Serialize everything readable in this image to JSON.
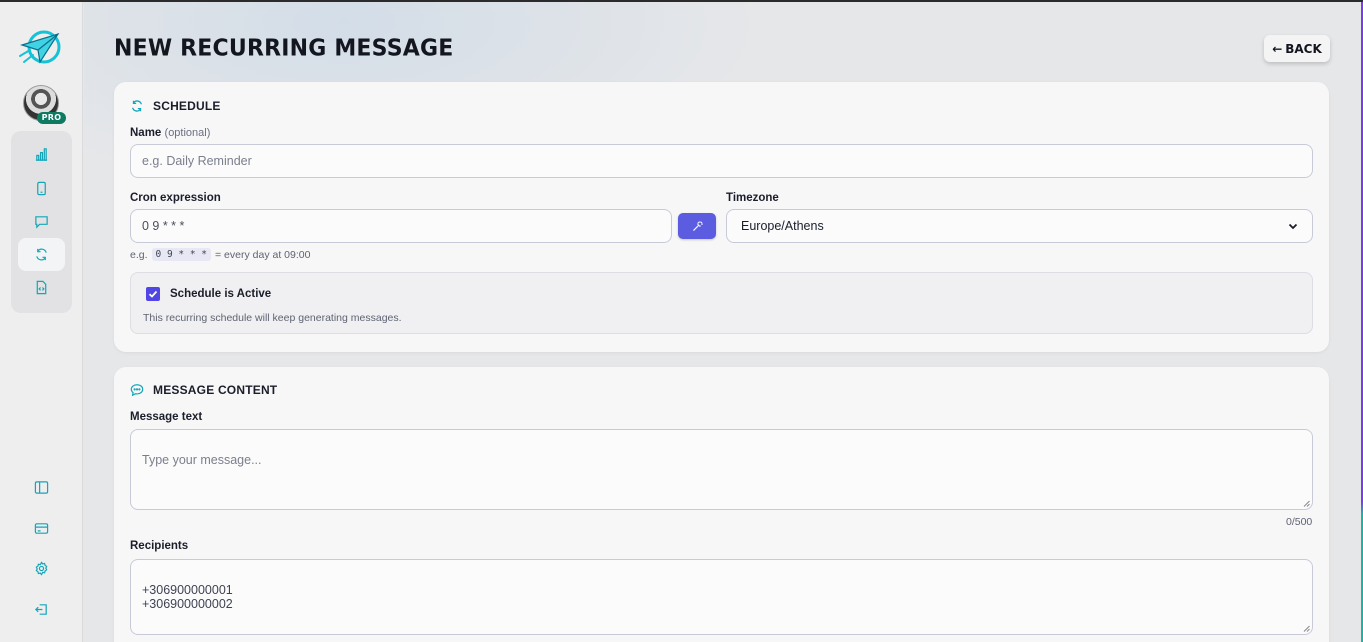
{
  "sidebar": {
    "badge": "PRO",
    "nav_icons": [
      "bar-chart-icon",
      "phone-icon",
      "message-icon",
      "refresh-icon",
      "file-code-icon"
    ],
    "bottom_icons": [
      "panel-icon",
      "credit-card-icon",
      "settings-icon",
      "logout-icon"
    ]
  },
  "header": {
    "title": "New Recurring Message",
    "back_label": "Back",
    "back_arrow": "←"
  },
  "schedule": {
    "title": "SCHEDULE",
    "name_label": "Name",
    "name_optional": "(optional)",
    "name_placeholder": "e.g. Daily Reminder",
    "cron_label": "Cron expression",
    "cron_value": "0 9 * * *",
    "cron_hint_prefix": "e.g.",
    "cron_hint_code": "0 9 * * *",
    "cron_hint_suffix": "= every day at 09:00",
    "timezone_label": "Timezone",
    "timezone_value": "Europe/Athens",
    "active_label": "Schedule is Active",
    "active_checked": true,
    "active_desc": "This recurring schedule will keep generating messages."
  },
  "content": {
    "title": "MESSAGE CONTENT",
    "message_label": "Message text",
    "message_placeholder": "Type your message...",
    "char_count": "0/500",
    "recipients_label": "Recipients",
    "recipients_value": "+306900000001\n+306900000002"
  },
  "colors": {
    "accent": "#5b5ce0",
    "teal": "#14b8a6",
    "checkbox": "#4f46e5",
    "badge": "#0f7a62"
  }
}
